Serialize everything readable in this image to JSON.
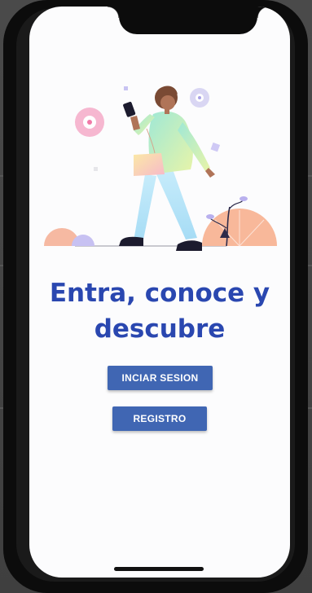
{
  "welcome": {
    "headline_line1": "Entra, conoce y",
    "headline_line2": "descubre",
    "login_button": "INCIAR SESION",
    "register_button": "REGISTRO"
  },
  "colors": {
    "headline": "#2a47b0",
    "button": "#4066b3",
    "screen_background": "#fcfcfd"
  },
  "illustration": {
    "subject": "woman-walking-with-phone",
    "icons": [
      "pink-disc-icon",
      "lavender-disc-icon",
      "peach-sun-icon",
      "plant-icon"
    ]
  }
}
